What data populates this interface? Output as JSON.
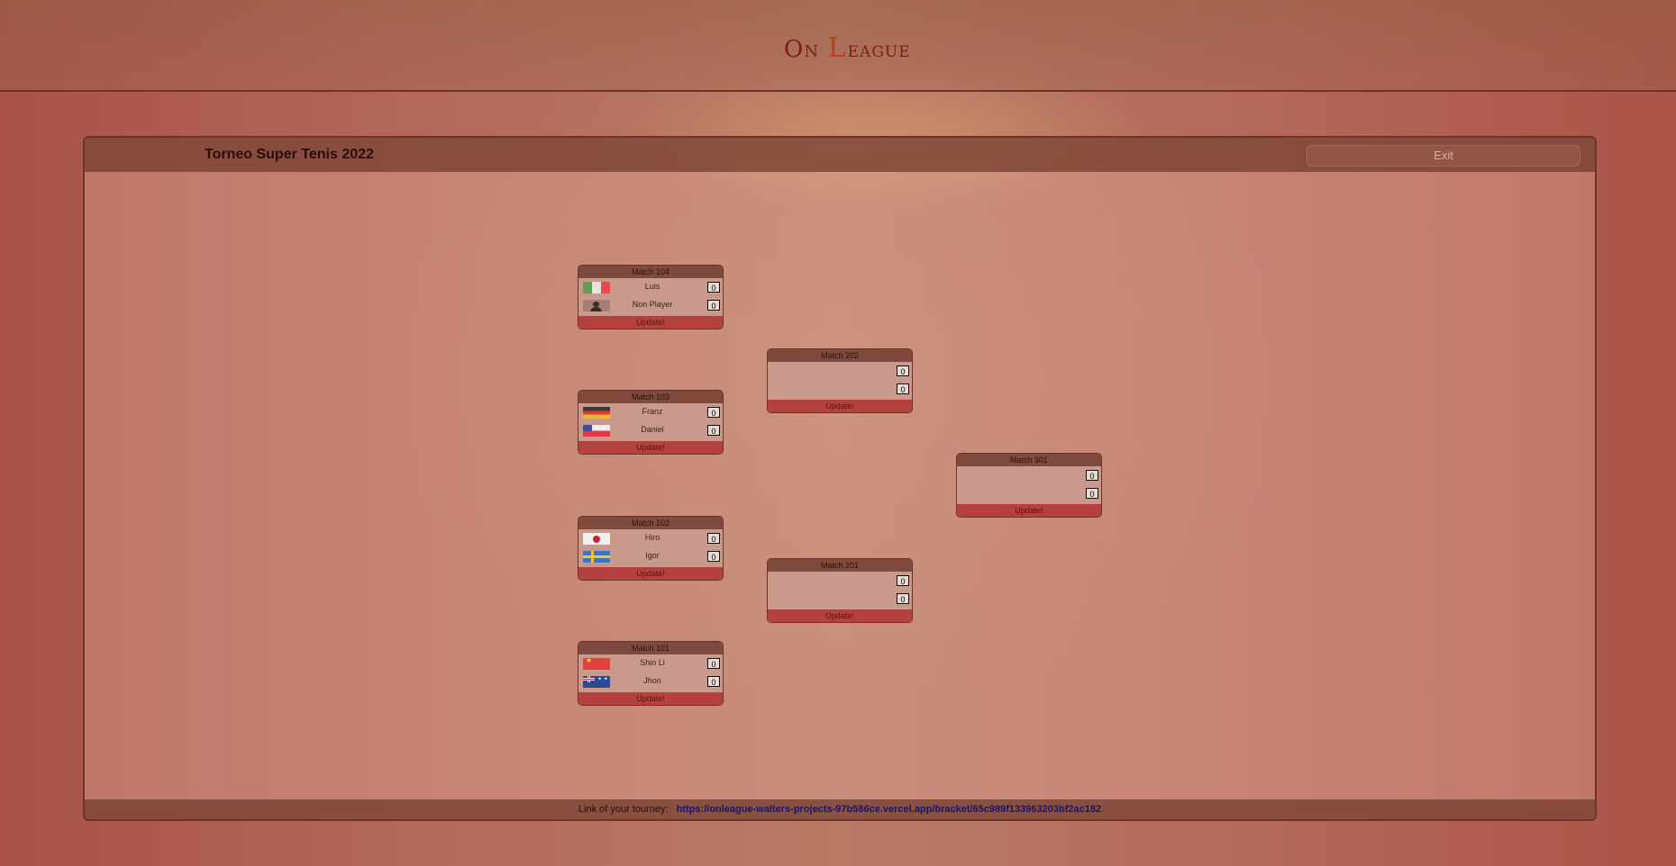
{
  "header": {
    "logo_on": "On",
    "logo_l": "L",
    "logo_eague": "eague"
  },
  "tournament": {
    "title": "Torneo Super Tenis 2022",
    "exit_label": "Exit"
  },
  "footer": {
    "link_label": "Link of your tourney:",
    "link_url": "https://onleague-walters-projects-97b586ce.vercel.app/bracket/65c989f133963203bf2ac182"
  },
  "update_label": "Update!",
  "matches": [
    {
      "title": "Match 104",
      "players": [
        {
          "name": "Luis",
          "flag": "mexico-flag",
          "score": "0"
        },
        {
          "name": "Non Player",
          "flag": "no-player-avatar",
          "score": "0"
        }
      ]
    },
    {
      "title": "Match 103",
      "players": [
        {
          "name": "Franz",
          "flag": "germany-flag",
          "score": "0"
        },
        {
          "name": "Daniel",
          "flag": "chile-flag",
          "score": "0"
        }
      ]
    },
    {
      "title": "Match 102",
      "players": [
        {
          "name": "Hiro",
          "flag": "japan-flag",
          "score": "0"
        },
        {
          "name": "Igor",
          "flag": "sweden-flag",
          "score": "0"
        }
      ]
    },
    {
      "title": "Match 101",
      "players": [
        {
          "name": "Shin Li",
          "flag": "china-flag",
          "score": "0"
        },
        {
          "name": "Jhon",
          "flag": "australia-flag",
          "score": "0"
        }
      ]
    },
    {
      "title": "Match 202",
      "players": [
        {
          "name": "",
          "score": "0"
        },
        {
          "name": "",
          "score": "0"
        }
      ]
    },
    {
      "title": "Match 201",
      "players": [
        {
          "name": "",
          "score": "0"
        },
        {
          "name": "",
          "score": "0"
        }
      ]
    },
    {
      "title": "Match 301",
      "players": [
        {
          "name": "",
          "score": "0"
        },
        {
          "name": "",
          "score": "0"
        }
      ]
    }
  ],
  "colors": {
    "header_bar": "#7d4a3d",
    "update_bar": "#b4413d",
    "logo": "#7a1e10"
  }
}
